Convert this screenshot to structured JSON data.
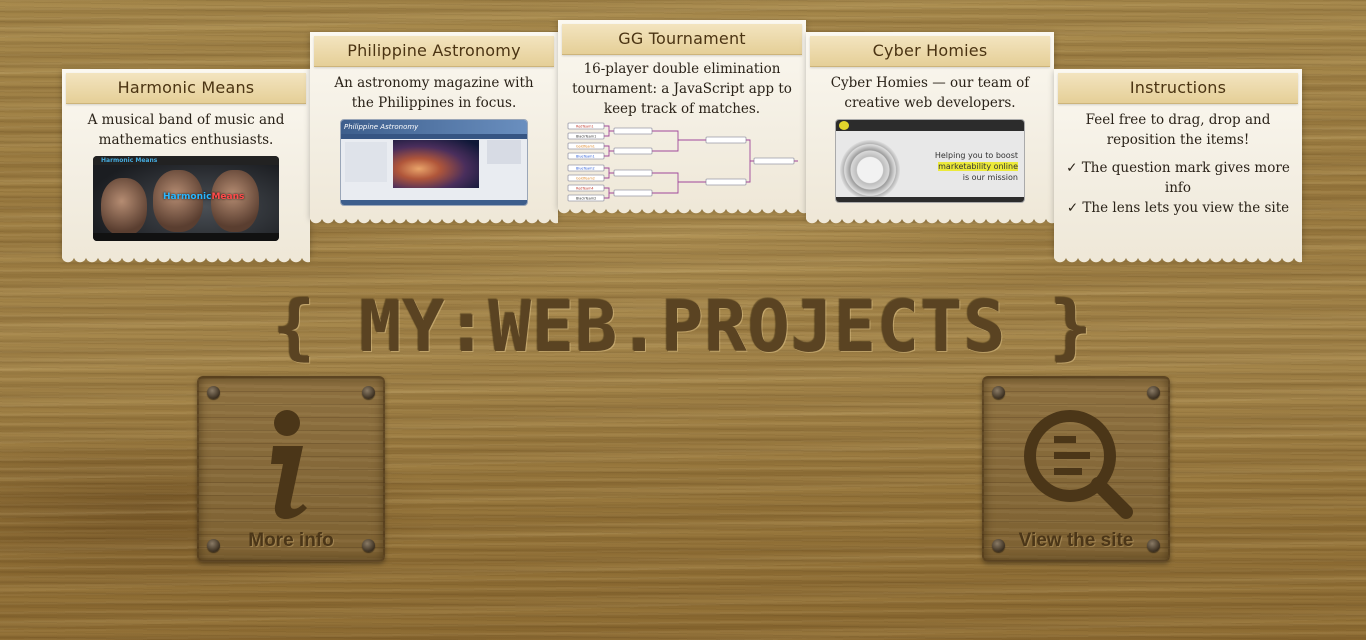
{
  "cards": {
    "harmonic": {
      "title": "Harmonic Means",
      "description": "A musical band of music and mathematics enthusiasts.",
      "thumb_logo": "Harmonic Means",
      "thumb_brand_a": "Harmonic",
      "thumb_brand_b": "Means"
    },
    "astronomy": {
      "title": "Philippine Astronomy",
      "description": "An astronomy magazine with the Philippines in focus.",
      "thumb_header": "Philippine Astronomy"
    },
    "gg": {
      "title": "GG Tournament",
      "description": "16-player double elimination tournament: a JavaScript app to keep track of matches."
    },
    "cyber": {
      "title": "Cyber Homies",
      "description": "Cyber Homies — our team of creative web developers.",
      "thumb_line1": "Helping you to boost",
      "thumb_line2": "marketability online",
      "thumb_line3": "is our mission"
    },
    "instructions": {
      "title": "Instructions",
      "description": "Feel free to drag, drop and reposition the items!",
      "items": [
        "✓ The question mark gives more info",
        "✓ The lens lets you view the site"
      ]
    }
  },
  "main_title": "{ MY:WEB.PROJECTS }",
  "buttons": {
    "more_info": {
      "label": "More info",
      "icon": "info-icon"
    },
    "view_site": {
      "label": "View the site",
      "icon": "magnifier-icon"
    }
  },
  "colors": {
    "wood": "#9c7c40",
    "paper": "#f5f0e4",
    "card_header": "#e5cf97",
    "title_text": "#5a4322"
  }
}
